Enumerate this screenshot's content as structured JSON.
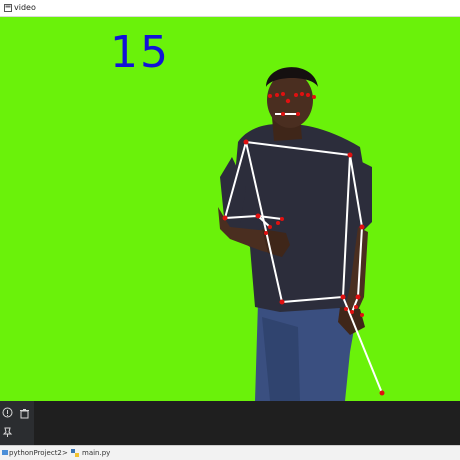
{
  "window": {
    "title": "video",
    "icon": "window-app-icon"
  },
  "video": {
    "counter": "15",
    "background_color": "#6af20a",
    "counter_color": "#1212d8",
    "landmark_color": "#e01010",
    "skeleton_color": "#ffffff"
  },
  "ide": {
    "gutter_icons": [
      "info-icon",
      "trash-icon",
      "pin-icon"
    ],
    "breadcrumb": {
      "project": "pythonProject2",
      "separator": ">",
      "file": "main.py"
    }
  }
}
